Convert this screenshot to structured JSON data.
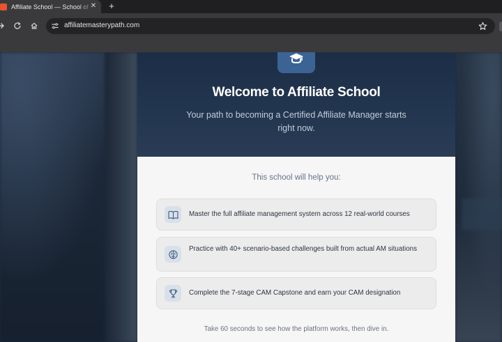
{
  "browser": {
    "tab_title": "Affiliate School — School of Performance Marketing",
    "tab_close_glyph": "✕",
    "new_tab_glyph": "+",
    "url": "affiliatemasterypath.com",
    "icons": [
      "forward-icon",
      "reload-icon",
      "home-icon",
      "site-info-icon",
      "star-icon"
    ]
  },
  "hero": {
    "logo_icon": "graduation-cap-icon",
    "title": "Welcome to Affiliate School",
    "subtitle": "Your path to becoming a Certified Affiliate Manager starts right now."
  },
  "body": {
    "heading": "This school will help you:",
    "features": [
      {
        "icon": "book-icon",
        "text": "Master the full affiliate management system across 12 real-world courses"
      },
      {
        "icon": "brain-icon",
        "text": "Practice with 40+ scenario-based challenges built from actual AM situations"
      },
      {
        "icon": "trophy-icon",
        "text": "Complete the 7-stage CAM Capstone and earn your CAM designation"
      }
    ],
    "footer": "Take 60 seconds to see how the platform works, then dive in."
  },
  "colors": {
    "hero_bg": "#1c2e46",
    "logo_bg": "#3b6494",
    "body_bg": "#f6f6f6",
    "feature_bg": "#ececec",
    "icon_bg": "#d8e0ea",
    "accent": "#3b6494"
  }
}
